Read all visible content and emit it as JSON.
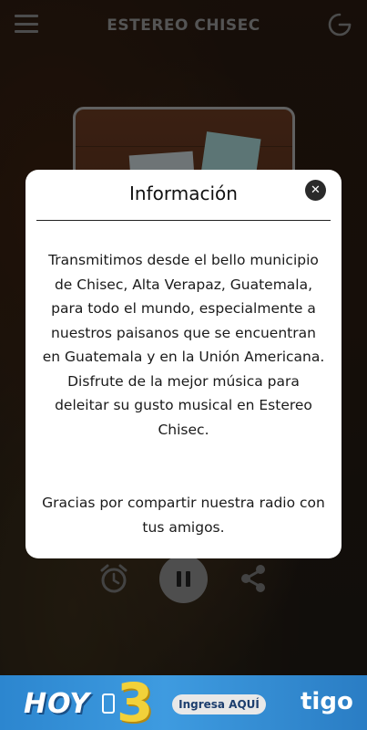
{
  "app": {
    "title": "ESTEREO CHISEC"
  },
  "icons": {
    "menu": "hamburger-menu-icon",
    "power": "power-icon",
    "alarm": "alarm-clock-icon",
    "pause": "pause-icon",
    "share": "share-icon",
    "close": "close-icon"
  },
  "modal": {
    "title": "Información",
    "close_label": "✕",
    "paragraph1": "Transmitimos desde el bello municipio de Chisec, Alta Verapaz, Guatemala, para todo el mundo, especialmente a nuestros paisanos que se encuentran en Guatemala y en la Unión Americana. Disfrute de la mejor música para deleitar su gusto musical en Estereo Chisec.",
    "paragraph2": "Gracias por compartir nuestra radio con tus amigos."
  },
  "ad": {
    "hoy": "HOY",
    "number": "3",
    "cta": "Ingresa AQUÍ",
    "brand": "tigo"
  },
  "colors": {
    "ad_blue": "#3e9be0",
    "ad_yellow": "#f2d13a",
    "modal_bg": "#ffffff"
  }
}
